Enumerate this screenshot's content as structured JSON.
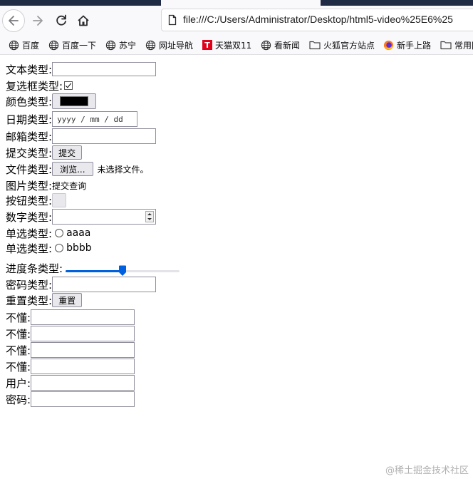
{
  "browser": {
    "url": "file:///C:/Users/Administrator/Desktop/html5-video%25E6%25",
    "bookmarks": [
      {
        "label": "百度",
        "icon": "globe-icon"
      },
      {
        "label": "百度一下",
        "icon": "globe-icon"
      },
      {
        "label": "苏宁",
        "icon": "globe-icon"
      },
      {
        "label": "网址导航",
        "icon": "globe-icon"
      },
      {
        "label": "天猫双11",
        "icon": "tmall-icon"
      },
      {
        "label": "看新闻",
        "icon": "globe-icon"
      },
      {
        "label": "火狐官方站点",
        "icon": "folder-icon"
      },
      {
        "label": "新手上路",
        "icon": "firefox-icon"
      },
      {
        "label": "常用网",
        "icon": "folder-icon"
      }
    ],
    "tmall_glyph": "T"
  },
  "form": {
    "text_label": "文本类型:",
    "checkbox_label": "复选框类型:",
    "checkbox_checked": true,
    "color_label": "颜色类型:",
    "color_value": "#000000",
    "date_label": "日期类型:",
    "date_placeholder": "yyyy / mm / dd",
    "email_label": "邮箱类型:",
    "submit_label": "提交类型:",
    "submit_button": "提交",
    "file_label": "文件类型:",
    "file_button": "浏览...",
    "file_status": "未选择文件。",
    "image_label": "图片类型:",
    "image_alt": "提交查询",
    "button_label": "按钮类型:",
    "number_label": "数字类型:",
    "radio_label_1": "单选类型:",
    "radio_text_1": "aaaa",
    "radio_label_2": "单选类型:",
    "radio_text_2": "bbbb",
    "range_label": "进度条类型:",
    "range_value": 0.5,
    "password_label": "密码类型:",
    "reset_label": "重置类型:",
    "reset_button": "重置",
    "extra_labels": [
      "不懂:",
      "不懂:",
      "不懂:",
      "不懂:",
      "用户:",
      "密码:"
    ]
  },
  "watermark": "@稀土掘金技术社区",
  "colors": {
    "accent": "#0060df",
    "chrome_dark": "#1f2a44"
  }
}
